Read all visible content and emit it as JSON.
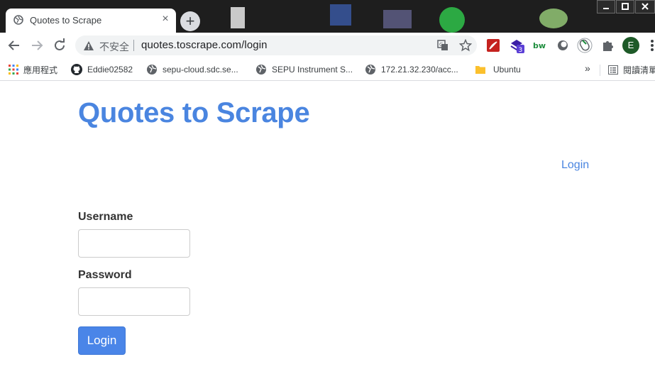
{
  "window": {
    "tab_title": "Quotes to Scrape",
    "tab_close_glyph": "×",
    "new_tab_glyph": "+"
  },
  "omnibox": {
    "security_label": "不安全",
    "url": "quotes.toscrape.com/login",
    "icons": [
      "translate-icon",
      "bookmark-star-icon"
    ]
  },
  "extensions": {
    "badge_count": "3",
    "bw_label": "bw",
    "profile_initial": "E",
    "icons": [
      "pdf-icon",
      "extension-3-icon",
      "bw-icon",
      "circle-icon",
      "mouse-icon",
      "puzzle-icon",
      "profile-avatar",
      "menu-icon"
    ]
  },
  "bookmarks": {
    "items": [
      {
        "label": "應用程式",
        "icon": "apps-grid-icon"
      },
      {
        "label": "Eddie02582",
        "icon": "github-icon"
      },
      {
        "label": "sepu-cloud.sdc.se...",
        "icon": "globe-icon"
      },
      {
        "label": "SEPU Instrument S...",
        "icon": "globe-icon"
      },
      {
        "label": "172.21.32.230/acc...",
        "icon": "globe-icon"
      },
      {
        "label": "Ubuntu",
        "icon": "folder-icon"
      }
    ],
    "overflow_glyph": "»",
    "reading_list_label": "閱讀清單"
  },
  "page": {
    "site_title": "Quotes to Scrape",
    "header_login_link": "Login",
    "form": {
      "username_label": "Username",
      "username_value": "",
      "password_label": "Password",
      "password_value": "",
      "submit_label": "Login"
    }
  },
  "colors": {
    "brand_blue": "#4a85e0",
    "button_blue": "#4a85e8",
    "label_text": "#333333"
  }
}
